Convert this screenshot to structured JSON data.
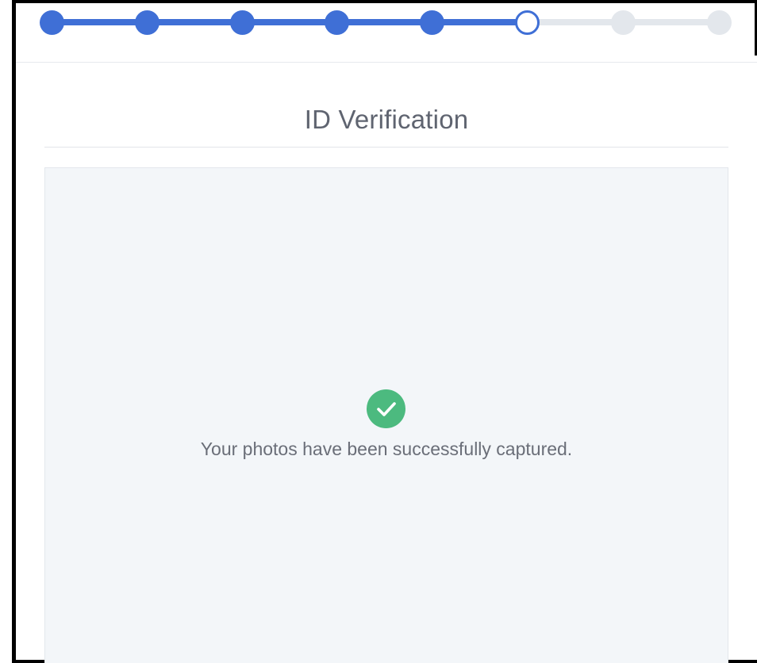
{
  "stepper": {
    "steps": [
      {
        "state": "done"
      },
      {
        "state": "done"
      },
      {
        "state": "done"
      },
      {
        "state": "done"
      },
      {
        "state": "done"
      },
      {
        "state": "current"
      },
      {
        "state": "todo"
      },
      {
        "state": "todo"
      }
    ],
    "colors": {
      "done": "#3f6fd6",
      "todo": "#e3e7ec"
    }
  },
  "page": {
    "title": "ID Verification"
  },
  "capture": {
    "status_icon": "check-circle-icon",
    "status_color": "#4cba7f",
    "message": "Your photos have been successfully captured."
  }
}
